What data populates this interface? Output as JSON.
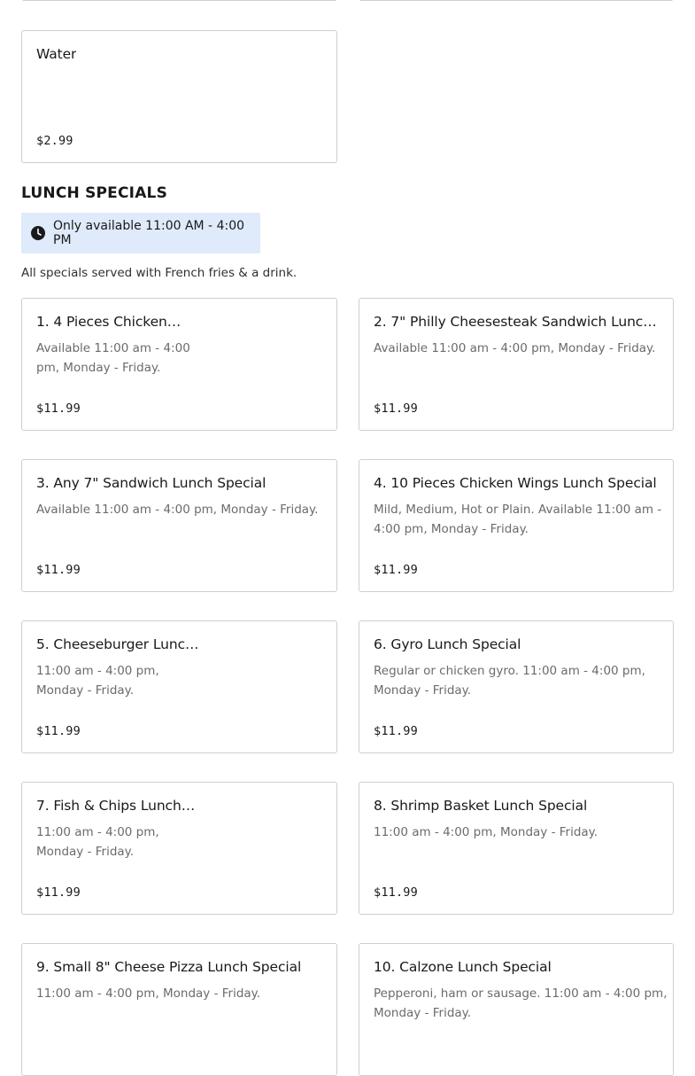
{
  "previous_items": [
    {
      "name": "Water",
      "price": "$2.99"
    }
  ],
  "lunch_specials": {
    "title": "LUNCH SPECIALS",
    "availability": "Only available 11:00 AM - 4:00 PM",
    "note": "All specials served with French fries & a drink.",
    "items": [
      {
        "name": "1. 4 Pieces Chicken…",
        "desc_lines": [
          "Available 11:00 am - 4:00",
          "pm, Monday - Friday."
        ],
        "price": "$11.99"
      },
      {
        "name": "2. 7\" Philly Cheesesteak Sandwich Lunch…",
        "desc_lines": [
          "Available 11:00 am - 4:00 pm, Monday - Friday."
        ],
        "price": "$11.99"
      },
      {
        "name": "3. Any 7\" Sandwich Lunch Special",
        "desc_lines": [
          "Available 11:00 am - 4:00 pm, Monday - Friday."
        ],
        "price": "$11.99"
      },
      {
        "name": "4. 10 Pieces Chicken Wings Lunch Special",
        "desc_lines": [
          "Mild, Medium, Hot or Plain. Available 11:00 am -",
          "4:00 pm, Monday - Friday."
        ],
        "price": "$11.99"
      },
      {
        "name": "5. Cheeseburger Lunc…",
        "desc_lines": [
          "11:00 am - 4:00 pm,",
          "Monday - Friday."
        ],
        "price": "$11.99"
      },
      {
        "name": "6. Gyro Lunch Special",
        "desc_lines": [
          "Regular or chicken gyro. 11:00 am - 4:00 pm,",
          "Monday - Friday."
        ],
        "price": "$11.99"
      },
      {
        "name": "7. Fish & Chips Lunch…",
        "desc_lines": [
          "11:00 am - 4:00 pm,",
          "Monday - Friday."
        ],
        "price": "$11.99"
      },
      {
        "name": "8. Shrimp Basket Lunch Special",
        "desc_lines": [
          "11:00 am - 4:00 pm, Monday - Friday."
        ],
        "price": "$11.99"
      },
      {
        "name": "9. Small 8\" Cheese Pizza Lunch Special",
        "desc_lines": [
          "11:00 am - 4:00 pm, Monday - Friday."
        ],
        "price": ""
      },
      {
        "name": "10. Calzone Lunch Special",
        "desc_lines": [
          "Pepperoni, ham or sausage. 11:00 am - 4:00 pm,",
          "Monday - Friday."
        ],
        "price": ""
      }
    ]
  },
  "icons": {
    "availability": "clock-icon"
  }
}
